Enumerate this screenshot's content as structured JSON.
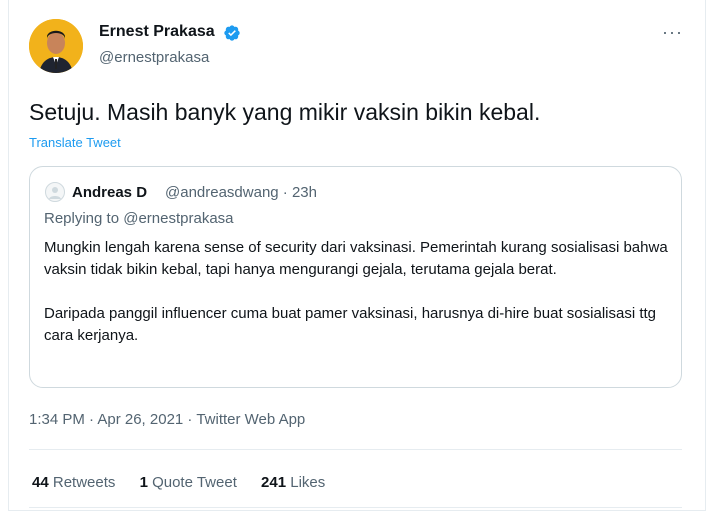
{
  "author": {
    "name": "Ernest Prakasa",
    "handle": "@ernestprakasa",
    "verified_icon": "verified-badge-icon"
  },
  "more_label": "···",
  "tweet": {
    "text": "Setuju. Masih banyk yang mikir vaksin bikin kebal.",
    "translate_label": "Translate Tweet"
  },
  "quote": {
    "name": "Andreas D",
    "meta": "@andreasdwang · 23h",
    "replying_label": "Replying to",
    "replying_handle": "@ernestprakasa",
    "paragraph1": "Mungkin lengah karena sense of security dari vaksinasi. Pemerintah kurang sosialisasi bahwa vaksin tidak bikin kebal, tapi hanya mengurangi gejala, terutama gejala berat.",
    "paragraph2": "Daripada panggil influencer cuma buat pamer vaksinasi, harusnya di-hire buat sosialisasi ttg cara kerjanya."
  },
  "timestamp": "1:34 PM · Apr 26, 2021 · Twitter Web App",
  "stats": {
    "retweets_count": "44",
    "retweets_label": "Retweets",
    "quotes_count": "1",
    "quotes_label": "Quote Tweet",
    "likes_count": "241",
    "likes_label": "Likes"
  },
  "colors": {
    "accent": "#1d9bf0",
    "avatar_bg": "#f2b21b",
    "secondary_text": "#536471"
  }
}
